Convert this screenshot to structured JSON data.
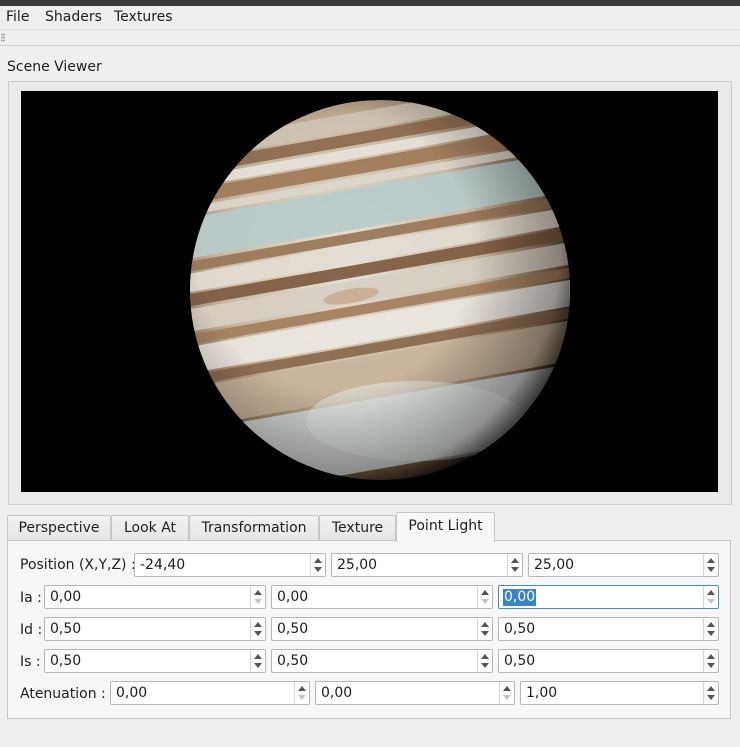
{
  "menu": {
    "items": [
      "File",
      "Shaders",
      "Textures"
    ]
  },
  "scene_viewer": {
    "title": "Scene Viewer"
  },
  "tabs": [
    "Perspective",
    "Look At",
    "Transformation",
    "Texture",
    "Point Light"
  ],
  "active_tab": "Point Light",
  "point_light": {
    "position": {
      "label": "Position (X,Y,Z) :",
      "values": [
        "-24,40",
        "25,00",
        "25,00"
      ]
    },
    "ia": {
      "label": "Ia :",
      "values": [
        "0,00",
        "0,00",
        "0,00"
      ]
    },
    "id": {
      "label": "Id :",
      "values": [
        "0,50",
        "0,50",
        "0,50"
      ]
    },
    "is": {
      "label": "Is :",
      "values": [
        "0,50",
        "0,50",
        "0,50"
      ]
    },
    "atenuation": {
      "label": "Atenuation :",
      "values": [
        "0,00",
        "0,00",
        "1,00"
      ]
    }
  },
  "colors": {
    "selection": "#3a84c6",
    "focus_border": "#3d8fd6",
    "viewport_bg": "#000000"
  },
  "icons": {
    "spin_up": "up-arrow-icon",
    "spin_down": "down-arrow-icon"
  }
}
